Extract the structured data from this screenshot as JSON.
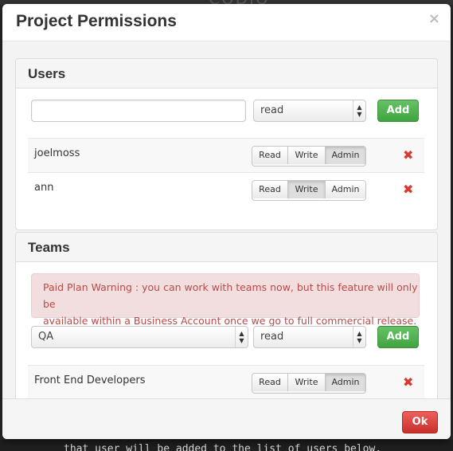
{
  "backdrop": {
    "logo": "CODIO",
    "bottom_text": "that user will be added to the list of users below."
  },
  "modal": {
    "title": "Project Permissions",
    "close_symbol": "×"
  },
  "users": {
    "heading": "Users",
    "input_value": "",
    "select_value": "read",
    "add_label": "Add",
    "rows": [
      {
        "name": "joelmoss",
        "active": "Admin"
      },
      {
        "name": "ann",
        "active": "Write"
      }
    ]
  },
  "teams": {
    "heading": "Teams",
    "warning_line1": "Paid Plan Warning : you can work with teams now, but this feature will only be",
    "warning_line2": "available within a Business Account once we go to full commercial release.",
    "team_select_value": "QA",
    "perm_select_value": "read",
    "add_label": "Add",
    "rows": [
      {
        "name": "Front End Developers",
        "active": "Admin"
      }
    ]
  },
  "permission_labels": {
    "read": "Read",
    "write": "Write",
    "admin": "Admin"
  },
  "remove_symbol": "✖",
  "footer": {
    "ok_label": "Ok"
  },
  "colors": {
    "add_button": "#46a946",
    "ok_button": "#d9453f",
    "remove_icon": "#d9382e",
    "alert_bg": "#f2dede",
    "alert_text": "#b94a48"
  }
}
